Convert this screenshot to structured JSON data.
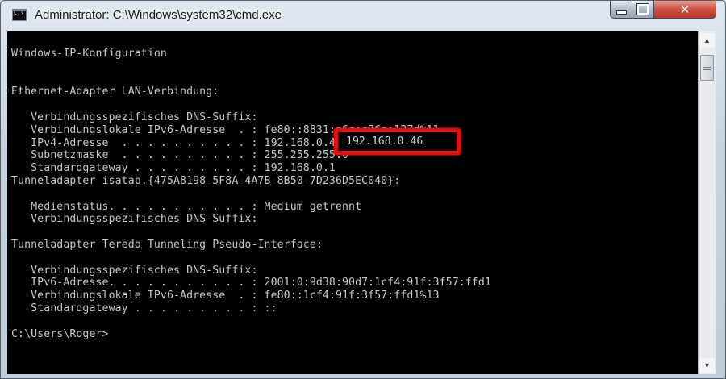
{
  "window": {
    "title": "Administrator: C:\\Windows\\system32\\cmd.exe",
    "icon_text": "C:\\"
  },
  "controls": {
    "close_glyph": "✕"
  },
  "console": {
    "lines": [
      "Windows-IP-Konfiguration",
      "",
      "",
      "Ethernet-Adapter LAN-Verbindung:",
      "",
      "   Verbindungsspezifisches DNS-Suffix:",
      "   Verbindungslokale IPv6-Adresse  . : fe80::8831:a6c:c76e:127d%11",
      "   IPv4-Adresse  . . . . . . . . . . : 192.168.0.46",
      "   Subnetzmaske  . . . . . . . . . . : 255.255.255.0",
      "   Standardgateway . . . . . . . . . : 192.168.0.1",
      "Tunneladapter isatap.{475A8198-5F8A-4A7B-8B50-7D236D5EC040}:",
      "",
      "   Medienstatus. . . . . . . . . . . : Medium getrennt",
      "   Verbindungsspezifisches DNS-Suffix:",
      "",
      "Tunneladapter Teredo Tunneling Pseudo-Interface:",
      "",
      "   Verbindungsspezifisches DNS-Suffix:",
      "   IPv6-Adresse. . . . . . . . . . . : 2001:0:9d38:90d7:1cf4:91f:3f57:ffd1",
      "   Verbindungslokale IPv6-Adresse  . : fe80::1cf4:91f:3f57:ffd1%13",
      "   Standardgateway . . . . . . . . . : ::",
      "",
      "C:\\Users\\Roger>"
    ],
    "highlight_text": "192.168.0.46",
    "highlight_color": "#e01010",
    "text_color": "#c7c7c7",
    "background": "#000000"
  },
  "scrollbar": {
    "up_glyph": "▲",
    "down_glyph": "▼"
  }
}
